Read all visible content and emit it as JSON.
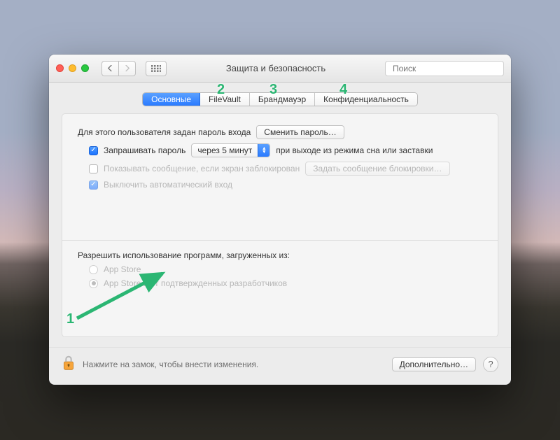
{
  "window": {
    "title": "Защита и безопасность",
    "search_placeholder": "Поиск"
  },
  "tabs": {
    "general": "Основные",
    "filevault": "FileVault",
    "firewall": "Брандмауэр",
    "privacy": "Конфиденциальность"
  },
  "pane": {
    "password_set_label": "Для этого пользователя задан пароль входа",
    "change_password_btn": "Сменить пароль…",
    "require_password_label": "Запрашивать пароль",
    "require_password_delay": "через 5 минут",
    "require_password_suffix": "при выходе из режима сна или заставки",
    "show_message_label": "Показывать сообщение, если экран заблокирован",
    "set_lock_message_btn": "Задать сообщение блокировки…",
    "disable_autologin_label": "Выключить автоматический вход",
    "allow_apps_label": "Разрешить использование программ, загруженных из:",
    "allow_apps_opt1": "App Store",
    "allow_apps_opt2": "App Store и от подтвержденных разработчиков"
  },
  "footer": {
    "lock_hint": "Нажмите на замок, чтобы внести изменения.",
    "advanced_btn": "Дополнительно…"
  },
  "annotations": {
    "n1": "1",
    "n2": "2",
    "n3": "3",
    "n4": "4"
  }
}
